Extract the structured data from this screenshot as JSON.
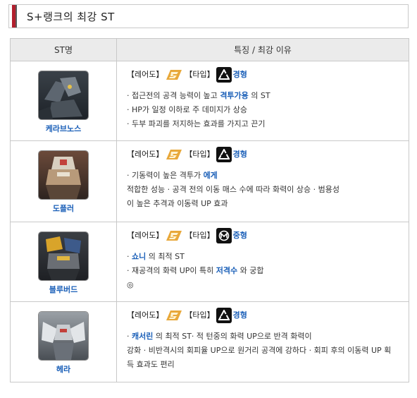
{
  "title": "S+랭크의 최강 ST",
  "headers": {
    "col1": "ST명",
    "col2": "특징 / 최강 이유"
  },
  "labels": {
    "rarity": "【레어도】",
    "type": "【타입】"
  },
  "rows": [
    {
      "name": "케라브노스",
      "type": "경형",
      "lines": [
        [
          "· 접근전의 공격 능력이 높고 ",
          "격투가용",
          " 의 ST"
        ],
        [
          "· HP가 일정 이하로 주 데미지가 상승"
        ],
        [
          "· 두부 파괴를 저지하는 효과를 가지고 끈기"
        ]
      ]
    },
    {
      "name": "도플러",
      "type": "경형",
      "lines": [
        [
          "· 기동력이 높은 격투가 ",
          "에게"
        ],
        [
          "적합한 성능 · 공격 전의 이동 매스 수에 따라 화력이 상승 · 범용성"
        ],
        [
          "이 높은 추격과 이동력 UP 효과"
        ]
      ]
    },
    {
      "name": "블루버드",
      "type": "중형",
      "lines": [
        [
          "· ",
          "쇼니",
          " 의 최적 ST"
        ],
        [
          "· 재공격의 화력 UP이 특히 ",
          "저격수",
          " 와 궁합"
        ],
        [
          "◎"
        ]
      ]
    },
    {
      "name": "헤라",
      "type": "경형",
      "lines": [
        [
          "· ",
          "캐서린",
          " 의 최적 ST· 적 턴중의 화력 UP으로 반격 화력이"
        ],
        [
          "강화 · 비반격시의 회피율 UP으로 원거리 공격에 강하다 · 회피 후의 이동력 UP 획"
        ],
        [
          "득 효과도 편리"
        ]
      ]
    }
  ]
}
